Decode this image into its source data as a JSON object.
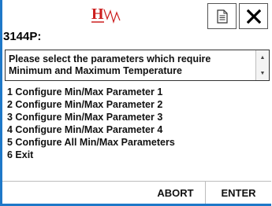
{
  "header": {
    "device_title": "3144P:",
    "logo_icon": "hart-logo",
    "doc_button_icon": "document-icon",
    "close_button_icon": "close-icon"
  },
  "prompt": {
    "text": "Please select the parameters which require Minimum and Maximum Temperature"
  },
  "menu": {
    "items": [
      {
        "label": "1 Configure Min/Max Parameter 1"
      },
      {
        "label": "2 Configure Min/Max Parameter 2"
      },
      {
        "label": "3 Configure Min/Max Parameter 3"
      },
      {
        "label": "4 Configure Min/Max Parameter 4"
      },
      {
        "label": "5 Configure All Min/Max Parameters"
      },
      {
        "label": "6 Exit"
      }
    ]
  },
  "footer": {
    "abort_label": "ABORT",
    "enter_label": "ENTER"
  },
  "colors": {
    "frame_accent": "#1e78c8",
    "logo_red": "#cc1f1f"
  }
}
